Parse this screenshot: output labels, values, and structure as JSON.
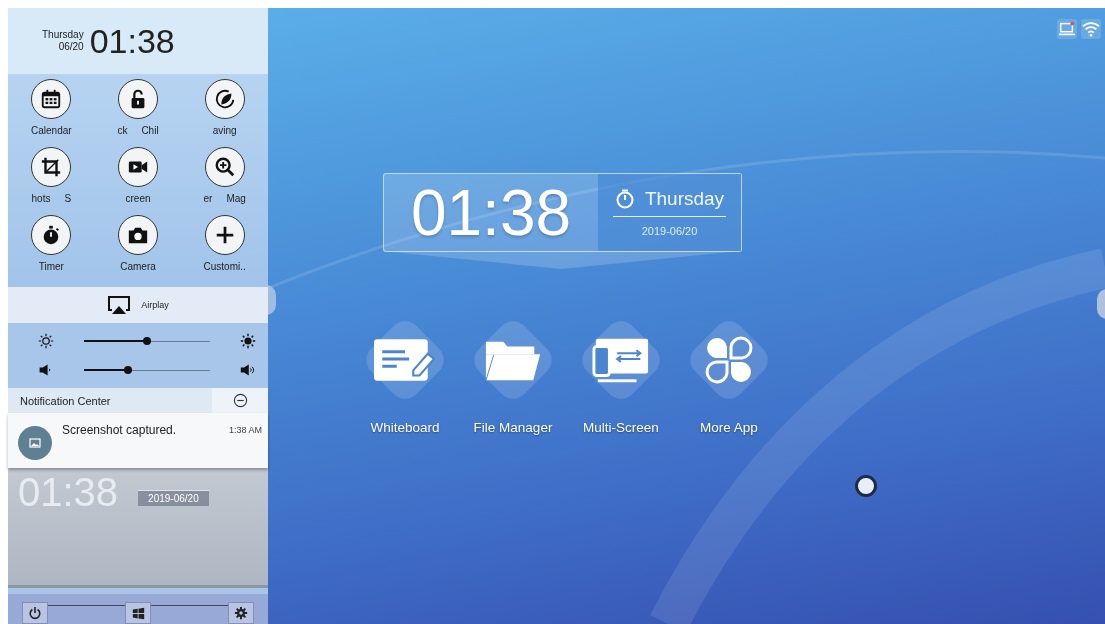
{
  "quick_panel": {
    "header": {
      "weekday": "Thursday",
      "date": "06/20",
      "time": "01:38"
    },
    "tiles": [
      {
        "labels": [
          "Calendar"
        ]
      },
      {
        "labels": [
          "ck",
          "Chil"
        ]
      },
      {
        "labels": [
          "aving"
        ]
      },
      {
        "labels": [
          "hots",
          "S"
        ]
      },
      {
        "labels": [
          "creen"
        ]
      },
      {
        "labels": [
          "er",
          "Mag"
        ]
      },
      {
        "labels": [
          "Timer"
        ]
      },
      {
        "labels": [
          "Camera"
        ]
      },
      {
        "labels": [
          "Customi.."
        ]
      }
    ],
    "airplay": {
      "label": "Airplay"
    },
    "sliders": [
      {
        "kind": "brightness",
        "level": 0.5
      },
      {
        "kind": "volume",
        "level": 0.35
      }
    ],
    "notification_center": {
      "title": "Notification Center",
      "items": [
        {
          "text": "Screenshot captured.",
          "time": "1:38 AM"
        }
      ]
    },
    "preview": {
      "time": "01:38",
      "date": "2019-06/20"
    }
  },
  "clock_widget": {
    "time": "01:38",
    "weekday": "Thursday",
    "date": "2019-06/20"
  },
  "apps": [
    {
      "label": "Whiteboard"
    },
    {
      "label": "File Manager"
    },
    {
      "label": "Multi-Screen"
    },
    {
      "label": "More App"
    }
  ]
}
